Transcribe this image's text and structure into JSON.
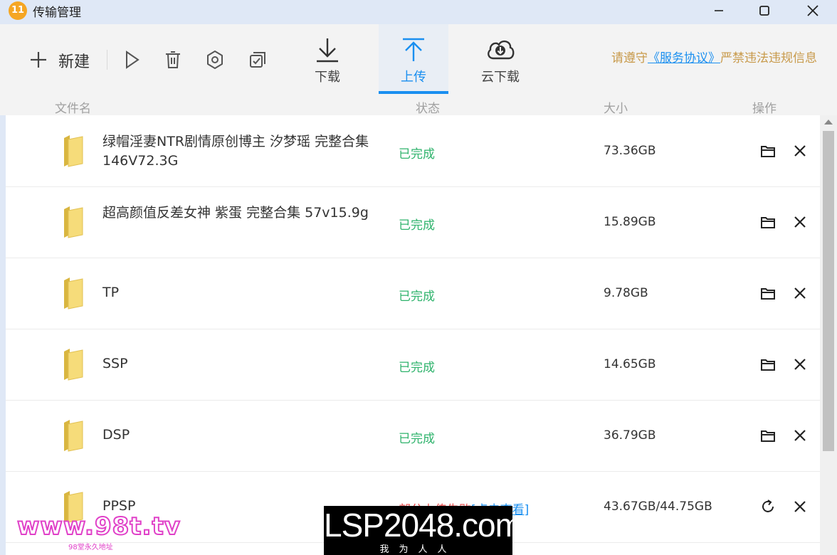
{
  "window": {
    "title": "传输管理",
    "logo_text": "11"
  },
  "toolbar": {
    "new_label": "新建",
    "tabs": [
      {
        "label": "下载"
      },
      {
        "label": "上传"
      },
      {
        "label": "云下载"
      }
    ],
    "notice_prefix": "请遵守",
    "notice_link": "《服务协议》",
    "notice_suffix": "严禁违法违规信息"
  },
  "columns": {
    "name": "文件名",
    "status": "状态",
    "size": "大小",
    "action": "操作"
  },
  "rows": [
    {
      "name": "绿帽淫妻NTR剧情原创博主 汐梦瑶 完整合集 146V72.3G",
      "status": "已完成",
      "size": "73.36GB"
    },
    {
      "name": "超高颜值反差女神 紫蛋 完整合集 57v15.9g",
      "status": "已完成",
      "size": "15.89GB"
    },
    {
      "name": "TP",
      "status": "已完成",
      "size": "9.78GB"
    },
    {
      "name": "SSP",
      "status": "已完成",
      "size": "14.65GB"
    },
    {
      "name": "DSP",
      "status": "已完成",
      "size": "36.79GB"
    },
    {
      "name": "PPSP",
      "status": "部分上传失败",
      "status_link": "[点击查看]",
      "size": "43.67GB/44.75GB"
    }
  ],
  "watermarks": {
    "left": "www.98t.tv",
    "left_sub": "98堂永久地址",
    "center": "LSP2048.com",
    "center_sub": "我为人人"
  },
  "colors": {
    "accent": "#1a8ff0",
    "success": "#2fb36c",
    "error": "#e84b4b",
    "notice": "#c89a4b"
  }
}
